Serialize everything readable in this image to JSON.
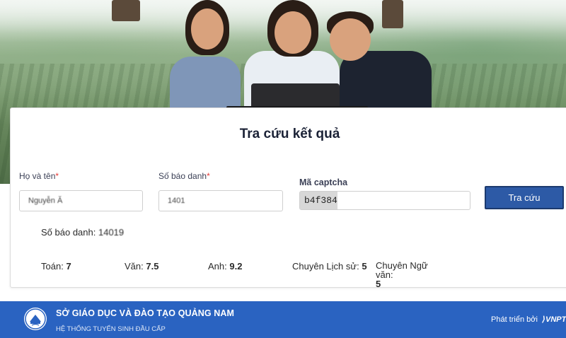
{
  "card": {
    "title": "Tra cứu kết quả"
  },
  "form": {
    "name_label": "Họ và tên",
    "name_value": "Nguyễn Ă",
    "sbd_label": "Số báo danh",
    "sbd_value": "1401",
    "required_mark": "*",
    "captcha_label": "Mã captcha",
    "captcha_code": "b4f384",
    "captcha_input_value": "",
    "search_button": "Tra cứu"
  },
  "result": {
    "sbd_label": "Số báo danh:",
    "sbd_value": "14019",
    "scores": [
      {
        "subject": "Toán:",
        "score": "7"
      },
      {
        "subject": "Văn:",
        "score": "7.5"
      },
      {
        "subject": "Anh:",
        "score": "9.2"
      },
      {
        "subject": "Chuyên Lịch sử:",
        "score": "5"
      },
      {
        "subject": "Chuyên Ngữ văn:",
        "score": "5"
      }
    ]
  },
  "footer": {
    "org": "SỞ GIÁO DỤC VÀ ĐÀO TẠO QUẢNG NAM",
    "subtitle": "HỆ THỐNG TUYỂN SINH ĐẦU CẤP",
    "developed_by": "Phát triển bởi",
    "developer": "VNPT"
  },
  "colors": {
    "primary": "#2a63c1",
    "button": "#2d5aa6",
    "required": "#e53935"
  }
}
